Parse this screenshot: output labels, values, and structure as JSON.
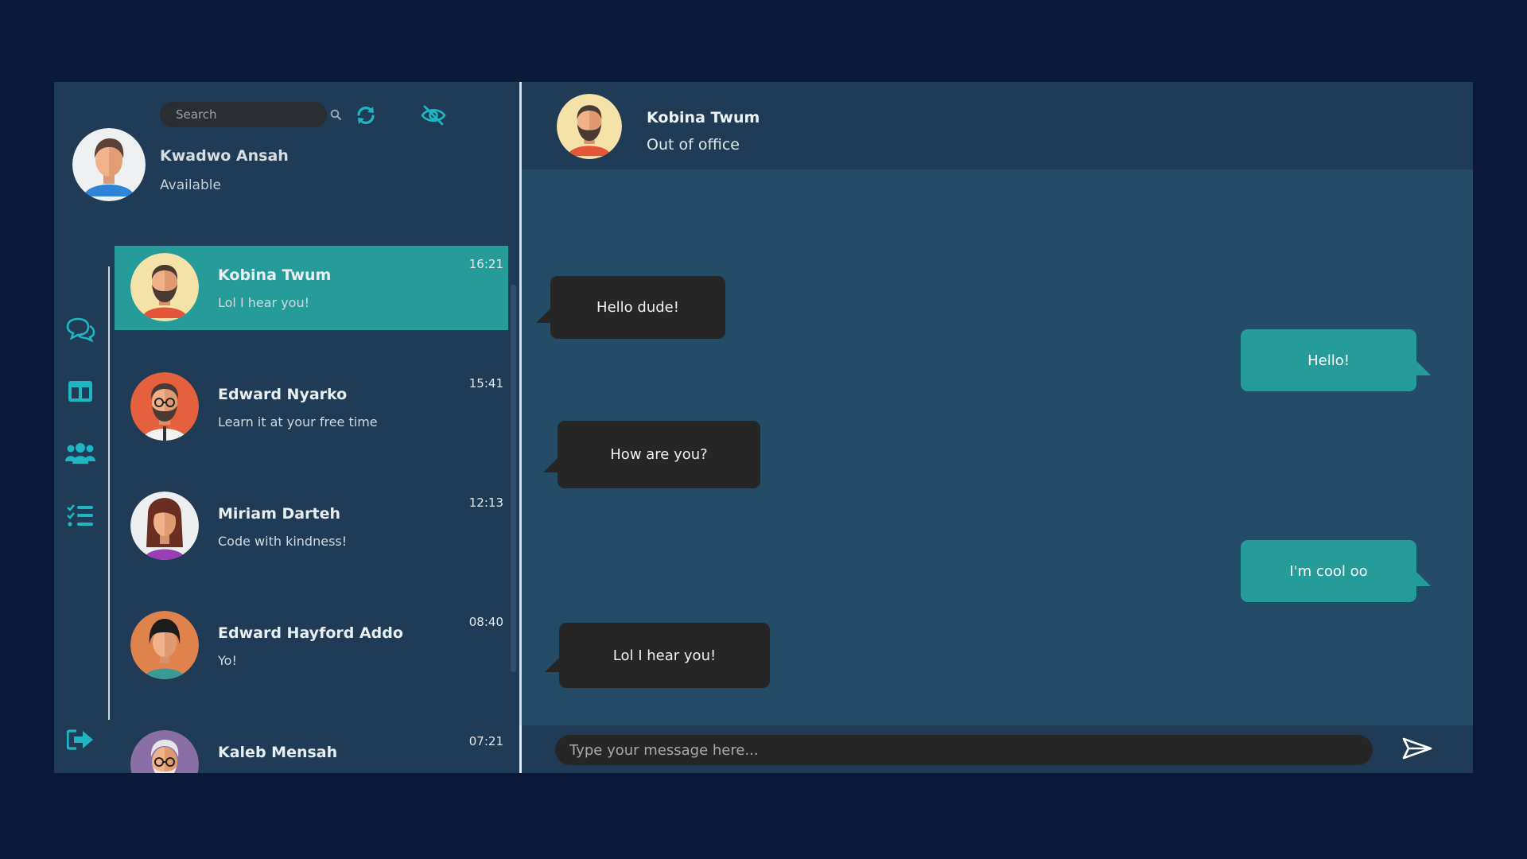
{
  "search": {
    "placeholder": "Search"
  },
  "me": {
    "name": "Kwadwo Ansah",
    "status": "Available"
  },
  "chats": [
    {
      "name": "Kobina Twum",
      "preview": "Lol I hear you!",
      "time": "16:21",
      "active": true
    },
    {
      "name": "Edward Nyarko",
      "preview": "Learn it at your free time",
      "time": "15:41"
    },
    {
      "name": "Miriam Darteh",
      "preview": "Code with kindness!",
      "time": "12:13"
    },
    {
      "name": "Edward Hayford Addo",
      "preview": "Yo!",
      "time": "08:40"
    },
    {
      "name": "Kaleb Mensah",
      "preview": "",
      "time": "07:21"
    }
  ],
  "conversation": {
    "name": "Kobina Twum",
    "status": "Out of office",
    "messages": [
      {
        "text": "Hello dude!",
        "direction": "incoming"
      },
      {
        "text": "Hello!",
        "direction": "outgoing"
      },
      {
        "text": "How are you?",
        "direction": "incoming"
      },
      {
        "text": "I'm cool oo",
        "direction": "outgoing"
      },
      {
        "text": "Lol I hear you!",
        "direction": "incoming"
      }
    ]
  },
  "composer": {
    "placeholder": "Type your message here..."
  },
  "icons": {
    "top": [
      "search-icon",
      "refresh-icon",
      "eye-slash-icon"
    ],
    "rail": [
      "chats-icon",
      "layout-columns-icon",
      "people-icon",
      "task-list-icon",
      "logout-icon"
    ],
    "send": "paper-plane-icon"
  },
  "colors": {
    "background": "#0c1a3a",
    "panel": "#1f3b55",
    "messages_bg": "#254c66",
    "accent": "#259c9a",
    "incoming_bubble": "#262626",
    "icon_accent": "#1fb5c2"
  }
}
